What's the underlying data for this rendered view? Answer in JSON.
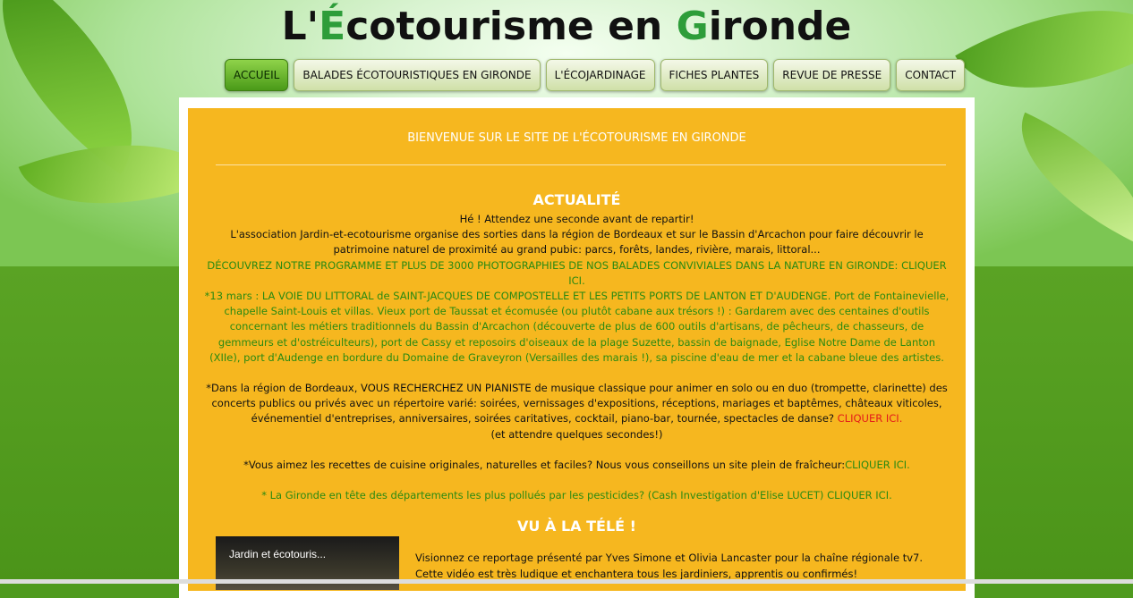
{
  "header": {
    "title_prefix": "L'",
    "title_e": "É",
    "title_mid": "cotourisme en ",
    "title_g": "G",
    "title_end": "ironde"
  },
  "nav": {
    "items": [
      {
        "label": "ACCUEIL",
        "active": true
      },
      {
        "label": "BALADES ÉCOTOURISTIQUES EN GIRONDE"
      },
      {
        "label": "L'ÉCOJARDINAGE"
      },
      {
        "label": "FICHES PLANTES"
      },
      {
        "label": "REVUE DE PRESSE"
      },
      {
        "label": "CONTACT"
      }
    ]
  },
  "welcome": "BIENVENUE SUR LE SITE DE L'ÉCOTOURISME EN GIRONDE",
  "news": {
    "heading": "ACTUALITÉ",
    "wait": "Hé ! Attendez une seconde avant de repartir!",
    "assoc_1": "L'association Jardin-et-ecotourisme organise des sorties dans la région de Bordeaux et sur le Bassin d'Arcachon pour faire découvrir le",
    "assoc_2": "patrimoine naturel de proximité au grand pubic: parcs, forêts, landes, rivière, marais, littoral...",
    "programme": "DÉCOUVREZ NOTRE PROGRAMME ET PLUS DE 3000 PHOTOGRAPHIES DE NOS BALADES CONVIVIALES DANS LA NATURE EN GIRONDE: CLIQUER ICI.",
    "outing_1": "*13 mars : LA VOIE DU LITTORAL de SAINT-JACQUES DE COMPOSTELLE ET LES PETITS PORTS DE LANTON ET D'AUDENGE. Port de Fontainevielle,",
    "outing_2": "chapelle Saint-Louis et villas. Vieux port de Taussat et écomusée (ou plutôt cabane aux trésors !) : Gardarem avec des centaines d'outils",
    "outing_3": "concernant les métiers traditionnels du Bassin d'Arcachon (découverte de plus de 600 outils d'artisans, de pêcheurs, de chasseurs, de",
    "outing_4": "gemmeurs et d'ostréiculteurs), port de Cassy et reposoirs d'oiseaux de la plage Suzette, bassin de baignade, Eglise Notre Dame de Lanton",
    "outing_5": "(XIIe), port d'Audenge en bordure du Domaine de Graveyron (Versailles des marais !), sa piscine d'eau de mer et la cabane bleue des artistes.",
    "pianist_1": "*Dans la région de Bordeaux, VOUS RECHERCHEZ UN PIANISTE de musique classique pour animer en solo ou en duo (trompette, clarinette) des",
    "pianist_2": "concerts publics ou privés avec un répertoire varié: soirées, vernissages d'expositions, réceptions, mariages et baptêmes, châteaux viticoles,",
    "pianist_3": "événementiel d'entreprises, anniversaires, soirées caritatives, cocktail, piano-bar, tournée, spectacles de danse?",
    "pianist_link": "CLIQUER ICI.",
    "pianist_4": "(et attendre quelques secondes!)",
    "recipes": "*Vous aimez les recettes de cuisine originales, naturelles et faciles? Nous vous conseillons un site plein de fraîcheur:",
    "recipes_link": "CLIQUER ICI.",
    "pesticides": "* La Gironde en tête des départements les plus pollués par les pesticides? (Cash Investigation d'Elise LUCET) CLIQUER ICI."
  },
  "tv": {
    "heading": "VU À LA TÉLÉ !",
    "video_title": "Jardin et écotouris...",
    "desc_1": "Visionnez ce reportage présenté par Yves Simone et Olivia Lancaster pour la chaîne régionale tv7.",
    "desc_2": "Cette vidéo est très ludique et enchantera tous les jardiniers, apprentis ou confirmés!"
  },
  "colors": {
    "panel": "#f6b71f",
    "accent_green": "#2a8a12",
    "link_red": "#e31a1a"
  }
}
